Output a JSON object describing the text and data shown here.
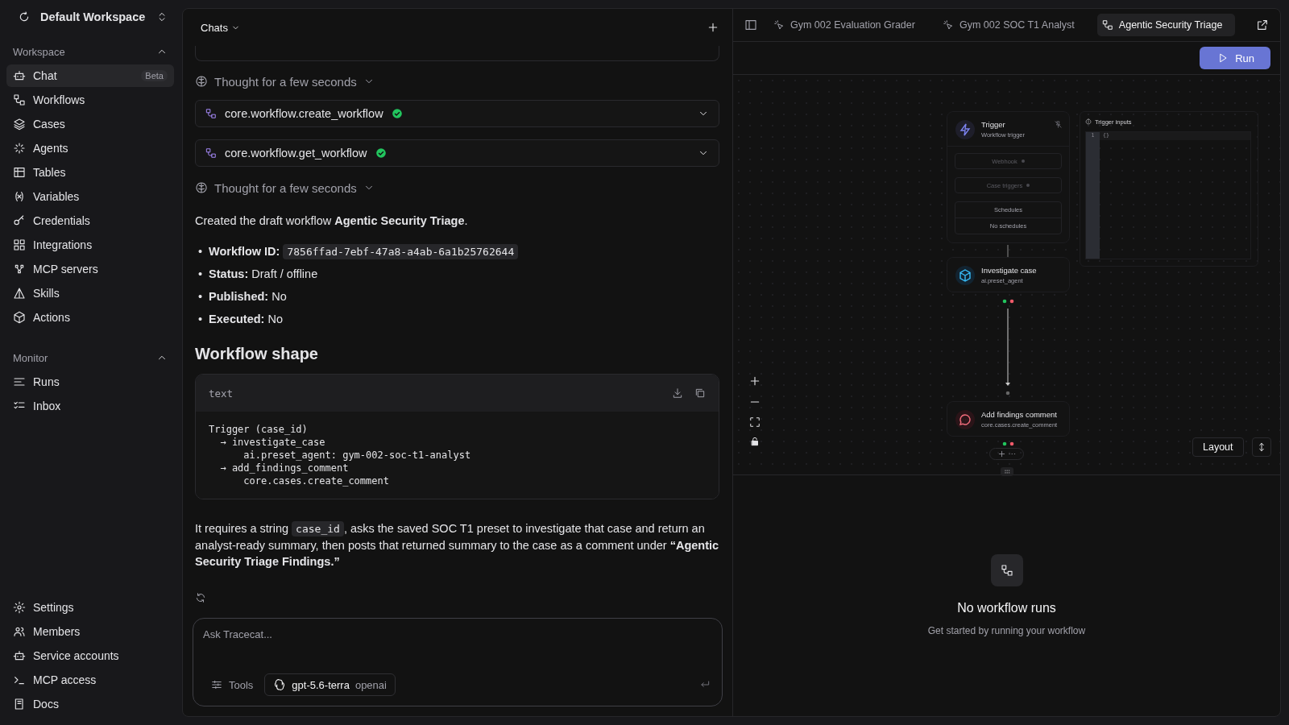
{
  "workspace": {
    "name": "Default Workspace"
  },
  "sidebar": {
    "sections": [
      {
        "title": "Workspace",
        "expanded": true,
        "items": [
          {
            "label": "Chat",
            "badge": "Beta",
            "selected": true
          },
          {
            "label": "Workflows",
            "selected": false
          },
          {
            "label": "Cases",
            "selected": false
          },
          {
            "label": "Agents",
            "selected": false
          },
          {
            "label": "Tables",
            "selected": false
          },
          {
            "label": "Variables",
            "selected": false
          },
          {
            "label": "Credentials",
            "selected": false
          },
          {
            "label": "Integrations",
            "selected": false
          },
          {
            "label": "MCP servers",
            "selected": false
          },
          {
            "label": "Skills",
            "selected": false
          },
          {
            "label": "Actions",
            "selected": false
          }
        ]
      },
      {
        "title": "Monitor",
        "expanded": true,
        "items": [
          {
            "label": "Runs",
            "selected": false
          },
          {
            "label": "Inbox",
            "selected": false
          }
        ]
      }
    ],
    "footer": [
      {
        "label": "Settings"
      },
      {
        "label": "Members"
      },
      {
        "label": "Service accounts"
      },
      {
        "label": "MCP access"
      },
      {
        "label": "Docs"
      }
    ]
  },
  "chat": {
    "title": "Chats",
    "messages": [
      {
        "kind": "thought",
        "text": "Thought for a few seconds"
      },
      {
        "kind": "tool",
        "text": "core.workflow.create_workflow",
        "done": true
      },
      {
        "kind": "tool",
        "text": "core.workflow.get_workflow",
        "done": true
      },
      {
        "kind": "thought",
        "text": "Thought for a few seconds"
      },
      {
        "kind": "paragraph",
        "parts": [
          {
            "kind": "text",
            "text": "Created the draft workflow **Agentic Security Triage**."
          }
        ]
      },
      {
        "kind": "list",
        "marker": "•",
        "items": [
          {
            "parts": [
              {
                "kind": "text",
                "text": "**Workflow ID:** "
              },
              {
                "kind": "code",
                "text": "7856ffad-7ebf-47a8-a4ab-6a1b25762644"
              }
            ]
          },
          {
            "parts": [
              {
                "kind": "text",
                "text": "**Status:** Draft / offline"
              }
            ]
          },
          {
            "parts": [
              {
                "kind": "text",
                "text": "**Published:** No"
              }
            ]
          },
          {
            "parts": [
              {
                "kind": "text",
                "text": "**Executed:** No"
              }
            ]
          }
        ]
      },
      {
        "kind": "heading",
        "text": "Workflow shape"
      },
      {
        "kind": "code",
        "language": "text",
        "lines": [
          "Trigger (case_id)",
          "  → investigate_case",
          "      ai.preset_agent: gym-002-soc-t1-analyst",
          "  → add_findings_comment",
          "      core.cases.create_comment"
        ]
      },
      {
        "kind": "paragraph",
        "parts": [
          {
            "kind": "text",
            "text": "It requires a string "
          },
          {
            "kind": "code",
            "text": "case_id"
          },
          {
            "kind": "text",
            "text": ", asks the saved SOC T1 preset to investigate that case and return an analyst-ready summary, then posts that returned summary to the case as a comment under **“Agentic Security Triage Findings.”**"
          }
        ]
      }
    ],
    "composer": {
      "placeholder": "Ask Tracecat...",
      "tools": "Tools",
      "model": "gpt-5.6-terra",
      "provider": "openai"
    }
  },
  "tabs": [
    {
      "label": "Gym 002 Evaluation Grader",
      "kind": "agent",
      "selected": false
    },
    {
      "label": "Gym 002 SOC T1 Analyst",
      "kind": "agent",
      "selected": false
    },
    {
      "label": "Agentic Security Triage",
      "kind": "workflow",
      "selected": true
    }
  ],
  "run_button": "Run",
  "canvas": {
    "nodes": [
      {
        "kind": "trigger",
        "title": "Trigger",
        "subtitle": "Workflow trigger",
        "triggers": [
          {
            "label": "Webhook",
            "enabled": false
          },
          {
            "label": "Case triggers",
            "enabled": false
          }
        ],
        "schedules": {
          "title": "Schedules",
          "empty": "No schedules"
        }
      },
      {
        "kind": "agent",
        "title": "Investigate case",
        "subtitle": "ai.preset_agent"
      },
      {
        "kind": "comment",
        "title": "Add findings comment",
        "subtitle": "core.cases.create_comment"
      }
    ],
    "inputs_panel": {
      "title": "Trigger inputs",
      "lines": [
        {
          "number": "1",
          "code": "{}"
        }
      ]
    },
    "layout_button": "Layout"
  },
  "runs": {
    "title": "No workflow runs",
    "subtitle": "Get started by running your workflow"
  }
}
